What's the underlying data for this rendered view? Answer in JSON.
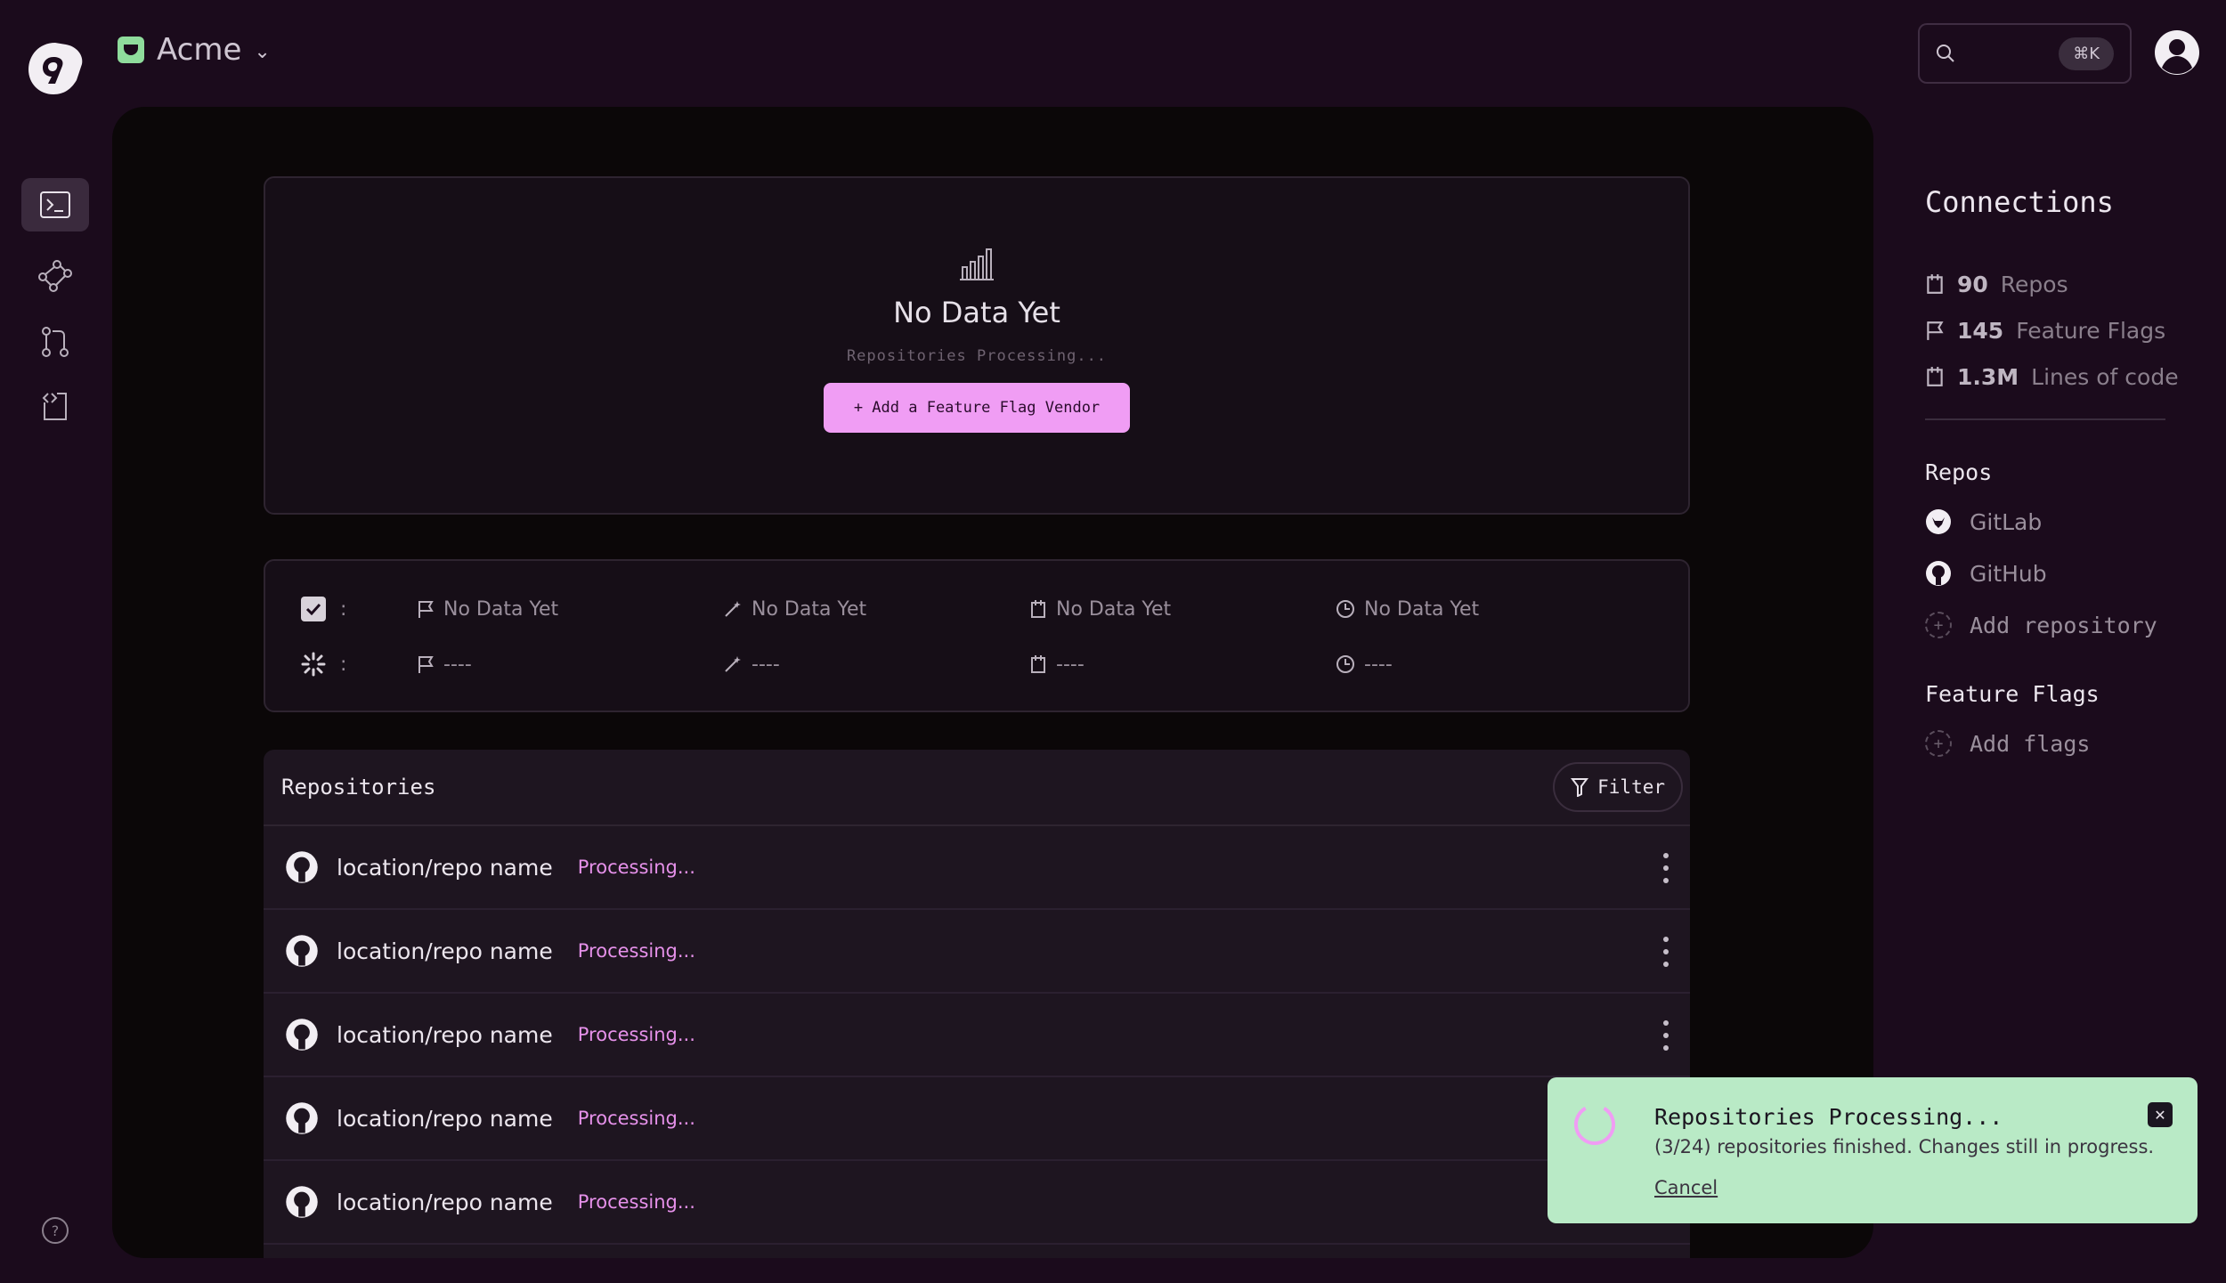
{
  "header": {
    "org_name": "Acme",
    "search_shortcut": "⌘K"
  },
  "nav": {
    "items": [
      "terminal-icon",
      "graph-icon",
      "git-branch-icon",
      "code-file-icon"
    ],
    "help_icon": "help-icon"
  },
  "empty_state": {
    "title": "No Data Yet",
    "subtitle": "Repositories Processing...",
    "button_label": "+ Add a Feature Flag Vendor"
  },
  "stats": {
    "rows": [
      {
        "sep": ":",
        "cells": [
          "No Data Yet",
          "No Data Yet",
          "No Data Yet",
          "No Data Yet"
        ]
      },
      {
        "sep": ":",
        "cells": [
          "----",
          "----",
          "----",
          "----"
        ]
      }
    ]
  },
  "repositories": {
    "title": "Repositories",
    "filter_label": "Filter",
    "rows": [
      {
        "name": "location/repo name",
        "status": "Processing..."
      },
      {
        "name": "location/repo name",
        "status": "Processing..."
      },
      {
        "name": "location/repo name",
        "status": "Processing..."
      },
      {
        "name": "location/repo name",
        "status": "Processing..."
      },
      {
        "name": "location/repo name",
        "status": "Processing..."
      }
    ]
  },
  "connections": {
    "title": "Connections",
    "items": [
      {
        "value": "90",
        "label": "Repos"
      },
      {
        "value": "145",
        "label": "Feature Flags"
      },
      {
        "value": "1.3M",
        "label": "Lines of code"
      }
    ],
    "repos_title": "Repos",
    "repos": [
      "GitLab",
      "GitHub"
    ],
    "add_repo": "Add repository",
    "flags_title": "Feature Flags",
    "add_flags": "Add flags"
  },
  "toast": {
    "title": "Repositories Processing...",
    "detail": "(3/24) repositories finished. Changes still in progress.",
    "cancel": "Cancel"
  },
  "colors": {
    "background": "#1b0b1c",
    "accent_pink": "#f09df4",
    "toast_green": "#b9eac6"
  }
}
